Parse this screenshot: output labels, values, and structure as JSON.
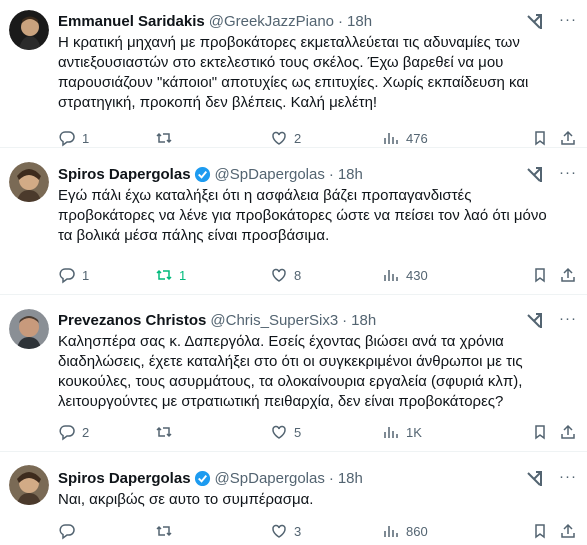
{
  "tweets": [
    {
      "name": "Emmanuel Saridakis",
      "handle": "@GreekJazzPiano",
      "dot": "·",
      "time": "18h",
      "text": "Η κρατική μηχανή με προβοκάτορες εκμεταλλεύεται τις αδυναμίες των\nαντιεξουσιαστών στο εκτελεστικό τους σκέλος. Έχω βαρεθεί να μου\nπαρουσιάζουν \"κάποιοι\" αποτυχίες ως επιτυχίες. Χωρίς εκπαίδευση και\nστρατηγική, προκοπή δεν βλέπεις. Καλή μελέτη!",
      "verified": false,
      "replies": "1",
      "retweets": "",
      "likes": "2",
      "views": "476",
      "more": "···"
    },
    {
      "name": "Spiros Dapergolas",
      "handle": "@SpDapergolas",
      "dot": "·",
      "time": "18h",
      "text": "Εγώ πάλι έχω καταλήξει ότι η ασφάλεια βάζει προπαγανδιστές\nπροβοκάτορες να λένε για προβοκάτορες ώστε να πείσει τον λαό ότι μόνο\nτα βολικά μέσα πάλης είναι προσβάσιμα.",
      "verified": true,
      "replies": "1",
      "retweets": "1",
      "likes": "8",
      "views": "430",
      "more": "···"
    },
    {
      "name": "Prevezanos Christos",
      "handle": "@Chris_SuperSix3",
      "dot": "·",
      "time": "18h",
      "text": "Καλησπέρα σας κ. Δαπεργόλα. Εσείς έχοντας βιώσει ανά τα χρόνια\nδιαδηλώσεις, έχετε καταλήξει στο ότι οι συγκεκριμένοι άνθρωποι με τις\nκουκούλες, τους ασυρμάτους, τα ολοκαίνουρια εργαλεία (σφυριά κλπ),\nλειτουργούντες με στρατιωτική πειθαρχία, δεν είναι προβοκάτορες?",
      "verified": false,
      "replies": "2",
      "retweets": "",
      "likes": "5",
      "views": "1K",
      "more": "···"
    },
    {
      "name": "Spiros Dapergolas",
      "handle": "@SpDapergolas",
      "dot": "·",
      "time": "18h",
      "text": "Ναι, ακριβώς σε αυτο το συμπέρασμα.",
      "verified": true,
      "replies": "",
      "retweets": "",
      "likes": "3",
      "views": "860",
      "more": "···"
    }
  ],
  "colors": {
    "text": "#0f1419",
    "muted": "#536471",
    "verified": "#1d9bf0",
    "retweet_active": "#00ba7c",
    "divider": "#eff3f4"
  },
  "icons": [
    "reply-icon",
    "retweet-icon",
    "like-icon",
    "views-icon",
    "bookmark-icon",
    "share-icon",
    "grok-icon",
    "more-icon",
    "verified-icon"
  ]
}
